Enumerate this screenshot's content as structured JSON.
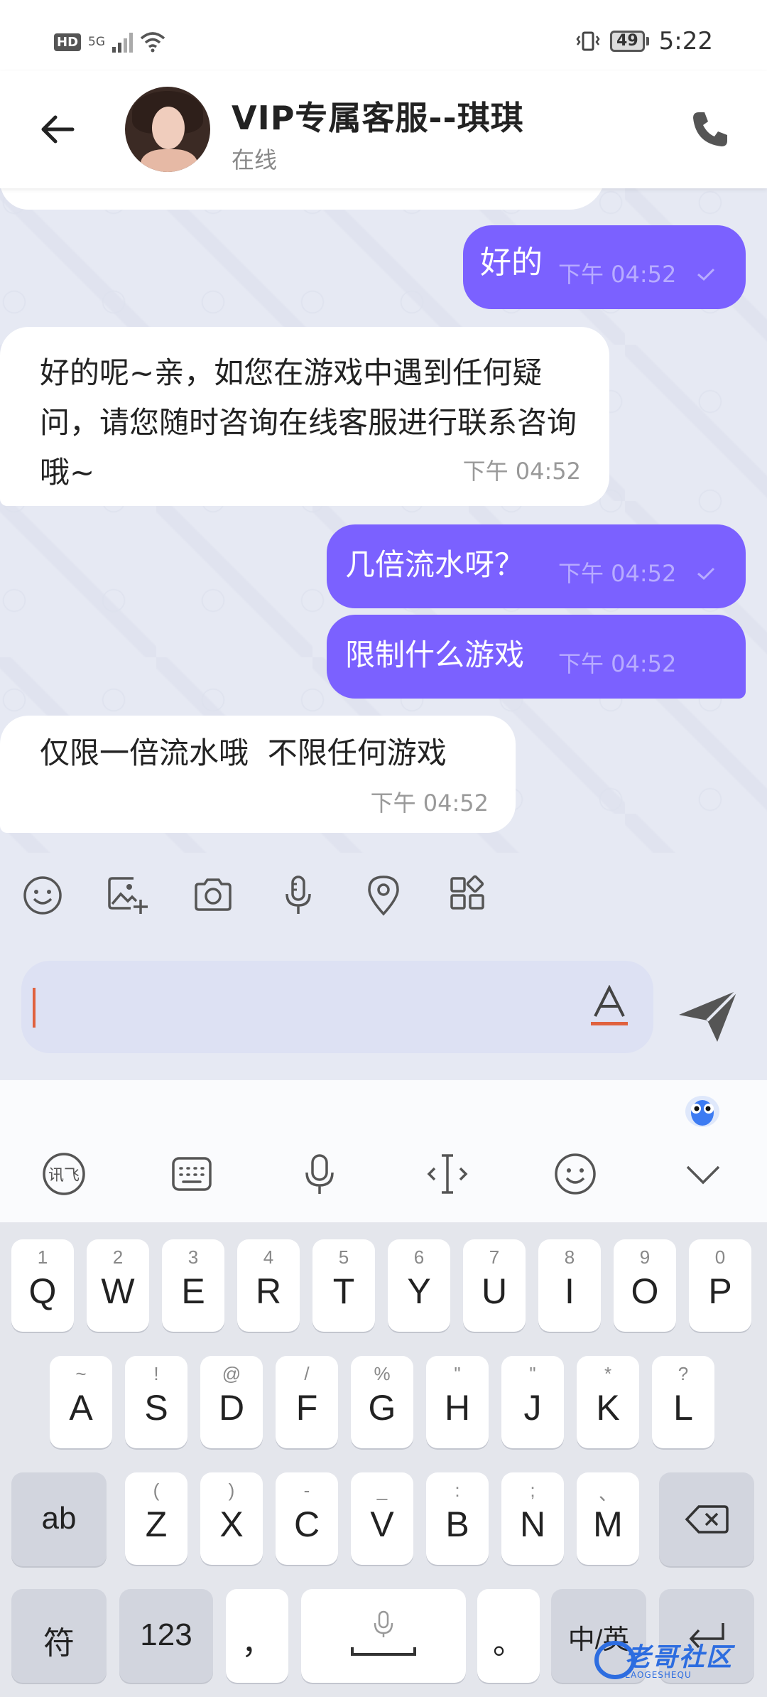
{
  "status_bar": {
    "hd": "HD",
    "network": "5G",
    "battery": "49",
    "time": "5:22"
  },
  "header": {
    "name": "VIP专属客服--琪琪",
    "status": "在线"
  },
  "messages": [
    {
      "side": "out",
      "text": "好的",
      "time": "下午 04:52",
      "read": true
    },
    {
      "side": "in",
      "text": "好的呢~亲，如您在游戏中遇到任何疑问，请您随时咨询在线客服进行联系咨询哦~",
      "time": "下午 04:52"
    },
    {
      "side": "out",
      "text": "几倍流水呀？",
      "time": "下午 04:52",
      "read": true
    },
    {
      "side": "out",
      "text": "限制什么游戏",
      "time": "下午 04:52",
      "read": false
    },
    {
      "side": "in",
      "text": "仅限一倍流水哦  不限任何游戏",
      "time": "下午 04:52"
    }
  ],
  "composer": {
    "placeholder": ""
  },
  "keyboard": {
    "row1": [
      {
        "sub": "1",
        "key": "Q"
      },
      {
        "sub": "2",
        "key": "W"
      },
      {
        "sub": "3",
        "key": "E"
      },
      {
        "sub": "4",
        "key": "R"
      },
      {
        "sub": "5",
        "key": "T"
      },
      {
        "sub": "6",
        "key": "Y"
      },
      {
        "sub": "7",
        "key": "U"
      },
      {
        "sub": "8",
        "key": "I"
      },
      {
        "sub": "9",
        "key": "O"
      },
      {
        "sub": "0",
        "key": "P"
      }
    ],
    "row2": [
      {
        "sub": "~",
        "key": "A"
      },
      {
        "sub": "!",
        "key": "S"
      },
      {
        "sub": "@",
        "key": "D"
      },
      {
        "sub": "/",
        "key": "F"
      },
      {
        "sub": "%",
        "key": "G"
      },
      {
        "sub": "\"",
        "key": "H"
      },
      {
        "sub": "\"",
        "key": "J"
      },
      {
        "sub": "*",
        "key": "K"
      },
      {
        "sub": "?",
        "key": "L"
      }
    ],
    "row3": [
      {
        "sub": "(",
        "key": "Z"
      },
      {
        "sub": ")",
        "key": "X"
      },
      {
        "sub": "-",
        "key": "C"
      },
      {
        "sub": "_",
        "key": "V"
      },
      {
        "sub": ":",
        "key": "B"
      },
      {
        "sub": ";",
        "key": "N"
      },
      {
        "sub": "、",
        "key": "M"
      }
    ],
    "ab": "ab",
    "symbols": "符",
    "numbers": "123",
    "comma": "，",
    "period": "。",
    "lang": "中/英"
  },
  "watermark": {
    "text": "老哥社区",
    "sub": "LAOGESHEQU"
  },
  "colors": {
    "accent": "#7b61ff",
    "chat_bg": "#e6e9f3",
    "caret": "#e0613e"
  }
}
